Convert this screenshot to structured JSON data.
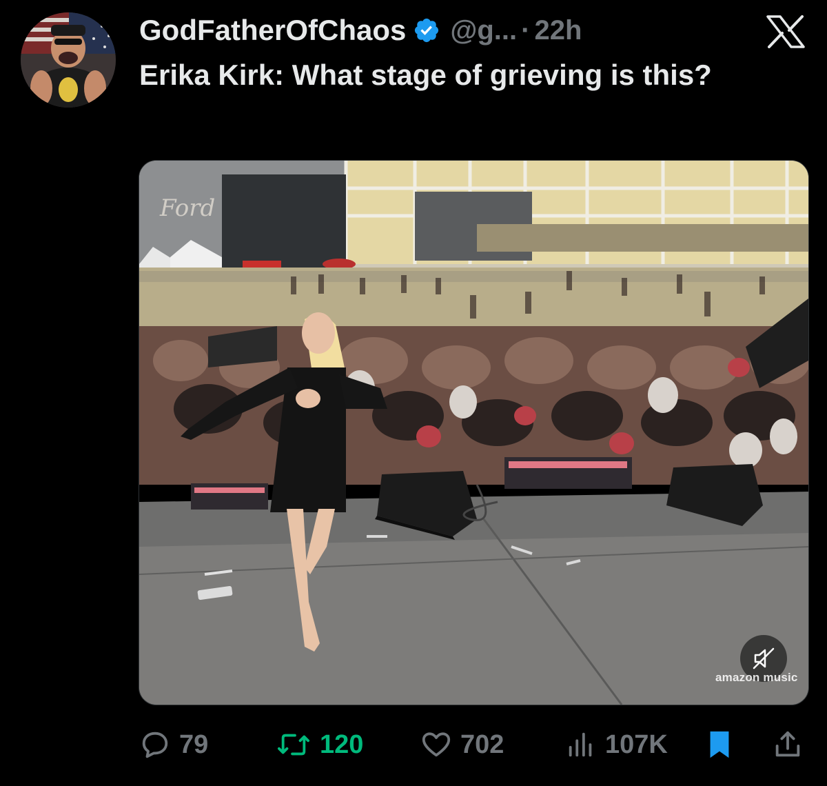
{
  "tweet": {
    "display_name": "GodFatherOfChaos",
    "handle": "@g...",
    "separator": "·",
    "time": "22h",
    "text": "Erika Kirk: What stage of grieving is this?",
    "verified": true
  },
  "media": {
    "watermark": "amazon music",
    "sign_text": "Ford",
    "mute_icon": "speaker-muted-icon"
  },
  "actions": {
    "replies": "79",
    "retweets": "120",
    "likes": "702",
    "views": "107K",
    "bookmarked": true
  },
  "colors": {
    "background": "#000000",
    "text": "#e7e9ea",
    "muted": "#71767b",
    "retweet_active": "#00ba7c",
    "verified_blue": "#1d9bf0",
    "bookmark_active": "#1d9bf0"
  }
}
